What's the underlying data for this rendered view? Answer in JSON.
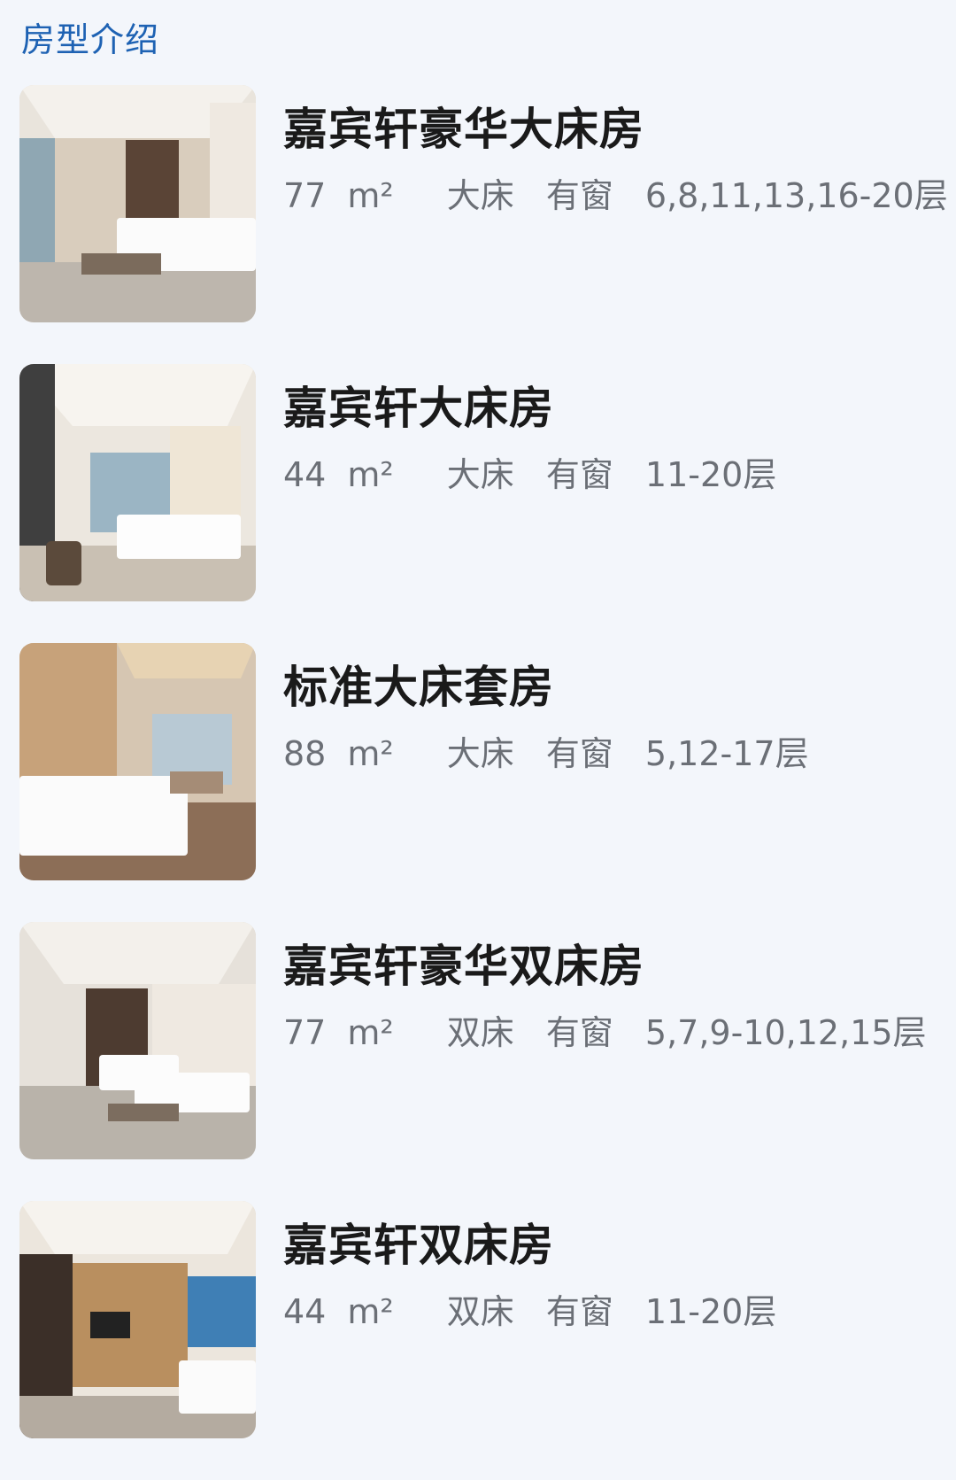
{
  "section": {
    "title": "房型介绍"
  },
  "rooms": [
    {
      "name": "嘉宾轩豪华大床房",
      "area": "77",
      "area_unit": "m²",
      "bed": "大床",
      "window": "有窗",
      "floors": "6,8,11,13,16-20层",
      "photo_icon": "hotel-room-photo"
    },
    {
      "name": "嘉宾轩大床房",
      "area": "44",
      "area_unit": "m²",
      "bed": "大床",
      "window": "有窗",
      "floors": "11-20层",
      "photo_icon": "hotel-room-photo"
    },
    {
      "name": "标准大床套房",
      "area": "88",
      "area_unit": "m²",
      "bed": "大床",
      "window": "有窗",
      "floors": "5,12-17层",
      "photo_icon": "hotel-room-photo"
    },
    {
      "name": "嘉宾轩豪华双床房",
      "area": "77",
      "area_unit": "m²",
      "bed": "双床",
      "window": "有窗",
      "floors": "5,7,9-10,12,15层",
      "photo_icon": "hotel-room-photo"
    },
    {
      "name": "嘉宾轩双床房",
      "area": "44",
      "area_unit": "m²",
      "bed": "双床",
      "window": "有窗",
      "floors": "11-20层",
      "photo_icon": "hotel-room-photo"
    }
  ],
  "colors": {
    "background": "#f3f6fb",
    "section_title": "#1e62b3",
    "room_name": "#1a1a1a",
    "room_meta": "#6b6f76"
  }
}
